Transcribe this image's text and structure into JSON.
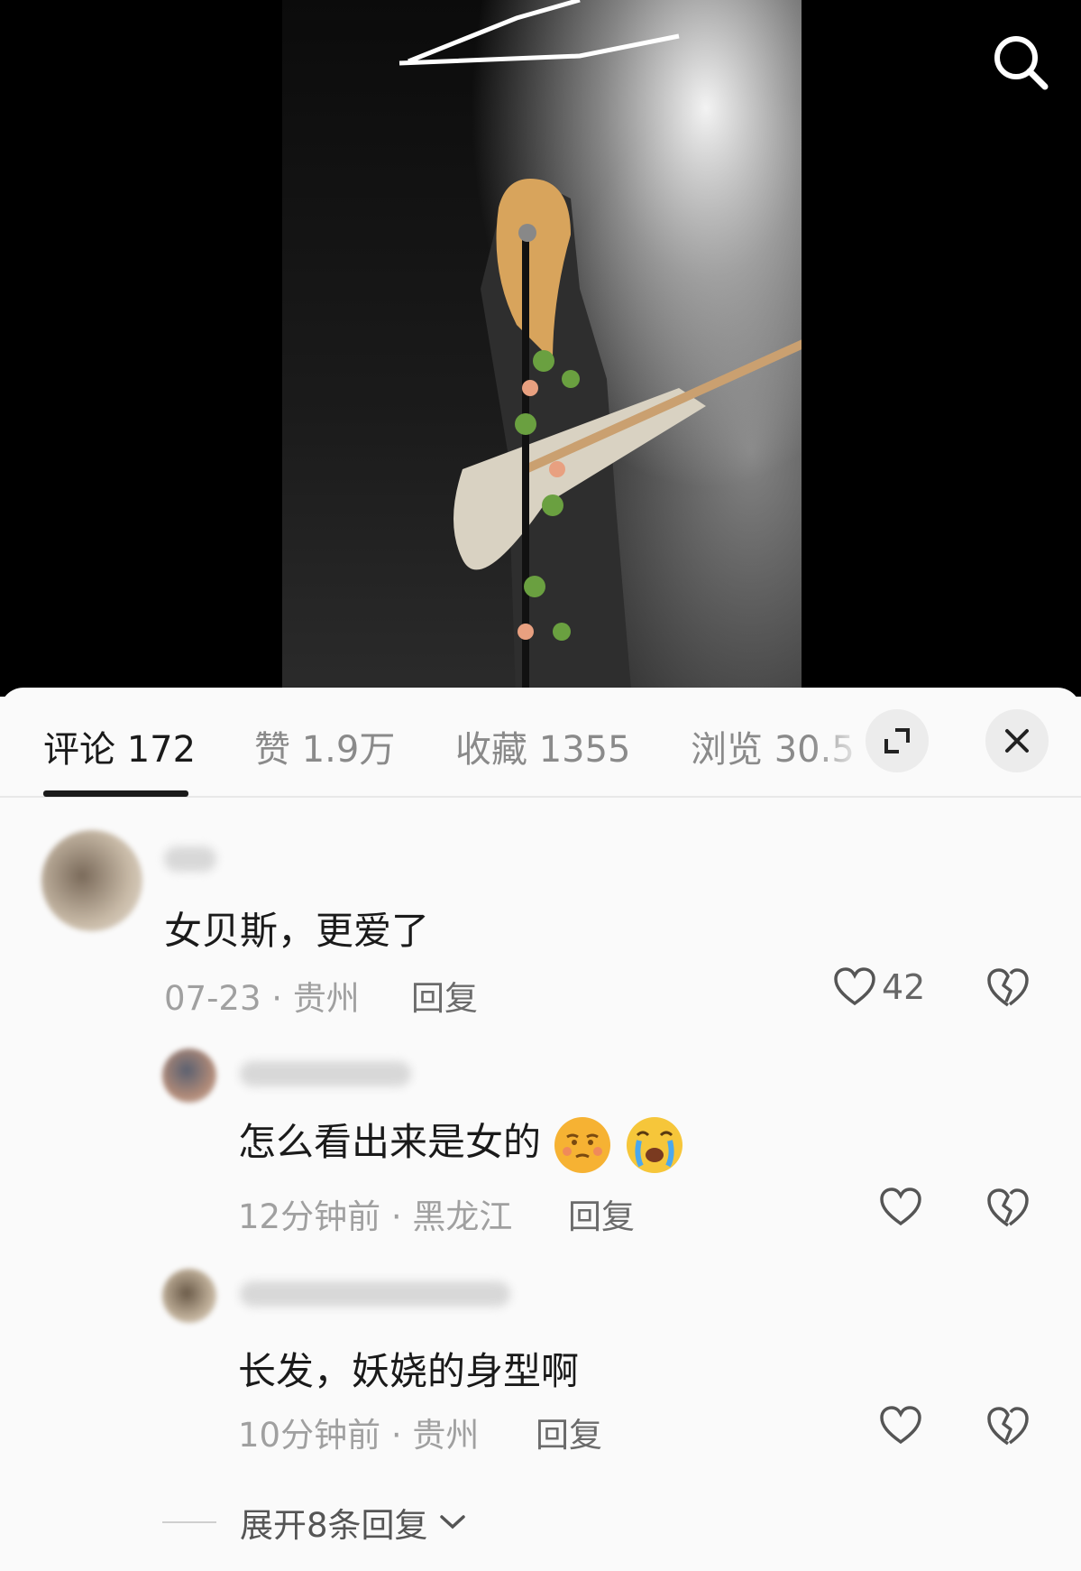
{
  "tabs": {
    "comments": "评论 172",
    "likes": "赞 1.9万",
    "favorites": "收藏 1355",
    "views": "浏览 30.5"
  },
  "icons": {
    "search": "search-icon",
    "expand": "expand-icon",
    "close": "close-icon",
    "like": "heart-icon",
    "dislike": "broken-heart-icon"
  },
  "comments": [
    {
      "text": "女贝斯，更爱了",
      "date": "07-23",
      "location": "贵州",
      "reply_label": "回复",
      "likes": "42"
    },
    {
      "text": "怎么看出来是女的",
      "emoji": [
        "smirk-emoji",
        "crying-emoji"
      ],
      "date": "12分钟前",
      "location": "黑龙江",
      "reply_label": "回复"
    },
    {
      "text": "长发，妖娆的身型啊",
      "date": "10分钟前",
      "location": "贵州",
      "reply_label": "回复"
    }
  ],
  "expand_replies": "展开8条回复",
  "colors": {
    "active_tab": "#1a1a1a",
    "inactive_tab": "#8a8a8a",
    "meta": "#a0a0a0"
  }
}
